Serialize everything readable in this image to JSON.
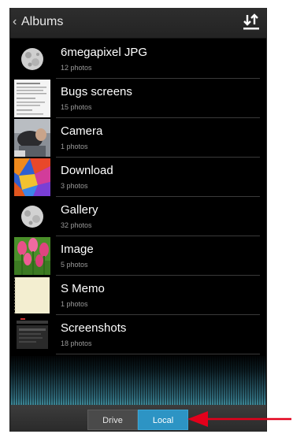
{
  "actionbar": {
    "back_glyph": "‹",
    "title": "Albums",
    "sort_icon": "sort-arrows-icon"
  },
  "albums": [
    {
      "title": "6megapixel JPG",
      "count": "12 photos",
      "thumb": "moon"
    },
    {
      "title": "Bugs screens",
      "count": "15 photos",
      "thumb": "document"
    },
    {
      "title": "Camera",
      "count": "1 photos",
      "thumb": "photo"
    },
    {
      "title": "Download",
      "count": "3 photos",
      "thumb": "abstract"
    },
    {
      "title": "Gallery",
      "count": "32 photos",
      "thumb": "moon"
    },
    {
      "title": "Image",
      "count": "5 photos",
      "thumb": "tulips"
    },
    {
      "title": "S Memo",
      "count": "1 photos",
      "thumb": "memo"
    },
    {
      "title": "Screenshots",
      "count": "18 photos",
      "thumb": "screenshot"
    }
  ],
  "bottombar": {
    "drive_label": "Drive",
    "local_label": "Local",
    "selected": "Local"
  },
  "colors": {
    "accent": "#2d94c4",
    "annotation_arrow": "#e3001b"
  }
}
